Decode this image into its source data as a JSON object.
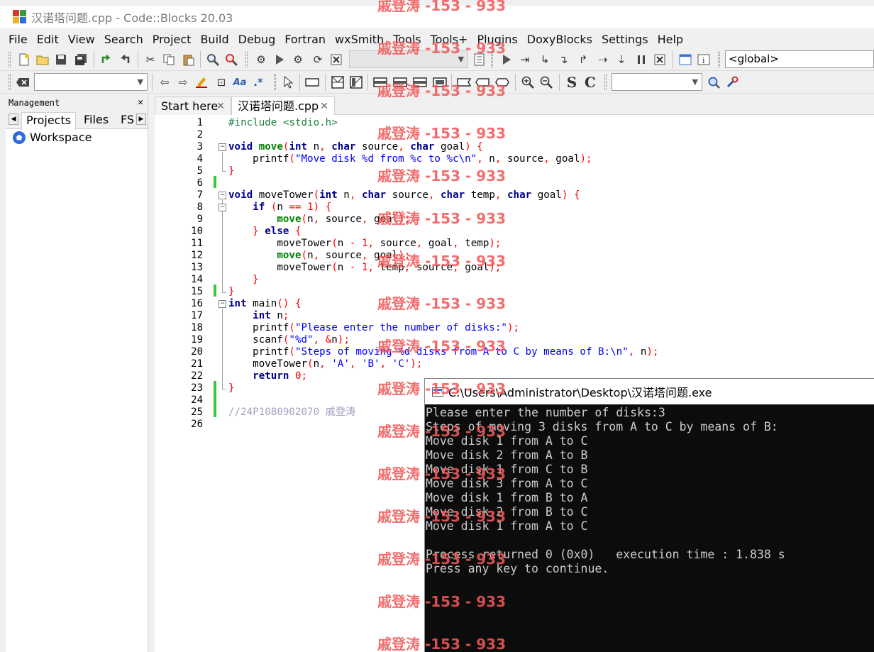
{
  "window": {
    "title": "汉诺塔问题.cpp - Code::Blocks 20.03"
  },
  "menu": [
    "File",
    "Edit",
    "View",
    "Search",
    "Project",
    "Build",
    "Debug",
    "Fortran",
    "wxSmith",
    "Tools",
    "Tools+",
    "Plugins",
    "DoxyBlocks",
    "Settings",
    "Help"
  ],
  "toolbar": {
    "global_scope": "<global>"
  },
  "management": {
    "title": "Management",
    "tabs": [
      "Projects",
      "Files",
      "FS"
    ],
    "tree_root": "Workspace"
  },
  "editor": {
    "tabs": [
      "Start here",
      "汉诺塔问题.cpp"
    ],
    "line_numbers": [
      "1",
      "2",
      "3",
      "4",
      "5",
      "6",
      "7",
      "8",
      "9",
      "10",
      "11",
      "12",
      "13",
      "14",
      "15",
      "16",
      "17",
      "18",
      "19",
      "20",
      "21",
      "22",
      "23",
      "24",
      "25",
      "26"
    ],
    "code_lines": [
      "#include <stdio.h>",
      "",
      "void move(int n, char source, char goal) {",
      "    printf(\"Move disk %d from %c to %c\\n\", n, source, goal);",
      "}",
      "",
      "void moveTower(int n, char source, char temp, char goal) {",
      "    if (n == 1) {",
      "        move(n, source, goal);",
      "    } else {",
      "        moveTower(n - 1, source, goal, temp);",
      "        move(n, source, goal);",
      "        moveTower(n - 1, temp, source, goal);",
      "    }",
      "}",
      "int main() {",
      "    int n;",
      "    printf(\"Please enter the number of disks:\");",
      "    scanf(\"%d\", &n);",
      "    printf(\"Steps of moving %d disks from A to C by means of B:\\n\", n);",
      "    moveTower(n, 'A', 'B', 'C');",
      "    return 0;",
      "}",
      "",
      "//24P1080902070 戚登涛",
      ""
    ]
  },
  "console": {
    "title": "C:\\Users\\Administrator\\Desktop\\汉诺塔问题.exe",
    "lines": [
      "Please enter the number of disks:3",
      "Steps of moving 3 disks from A to C by means of B:",
      "Move disk 1 from A to C",
      "Move disk 2 from A to B",
      "Move disk 1 from C to B",
      "Move disk 3 from A to C",
      "Move disk 1 from B to A",
      "Move disk 2 from B to C",
      "Move disk 1 from A to C",
      "",
      "Process returned 0 (0x0)   execution time : 1.838 s",
      "Press any key to continue."
    ]
  },
  "watermark": "戚登涛 -153 - 933"
}
